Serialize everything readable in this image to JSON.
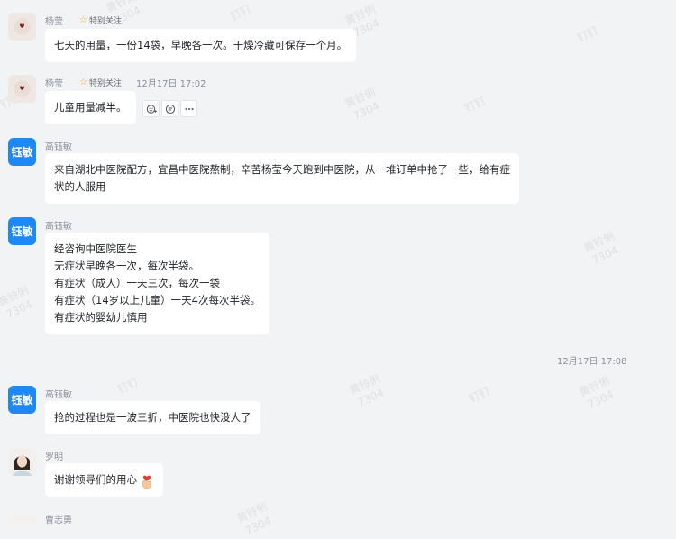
{
  "watermark": {
    "name": "黄铃俐",
    "code": "7304",
    "brand": "钉钉"
  },
  "messages": [
    {
      "sender": "杨莹",
      "special_tag": "特别关注",
      "time": "",
      "lines": [
        "七天的用量，一份14袋，早晚各一次。干燥冷藏可保存一个月。"
      ]
    },
    {
      "sender": "杨莹",
      "special_tag": "特别关注",
      "time": "12月17日 17:02",
      "lines": [
        "儿童用量减半。"
      ]
    },
    {
      "sender": "高钰敏",
      "avatar_text": "钰敏",
      "lines": [
        "来自湖北中医院配方，宜昌中医院熬制，辛苦杨莹今天跑到中医院，从一堆订单中抢了一些，给有症",
        "状的人服用"
      ]
    },
    {
      "sender": "高钰敏",
      "avatar_text": "钰敏",
      "lines": [
        "经咨询中医院医生",
        "无症状早晚各一次，每次半袋。",
        "有症状（成人）一天三次，每次一袋",
        "有症状（14岁以上儿童）一天4次每次半袋。",
        "有症状的婴幼儿慎用"
      ]
    },
    {
      "sender": "高钰敏",
      "avatar_text": "钰敏",
      "lines": [
        "抢的过程也是一波三折，中医院也快没人了"
      ]
    },
    {
      "sender": "罗明",
      "lines": [
        "谢谢领导们的用心"
      ]
    },
    {
      "sender": "曹志勇"
    }
  ],
  "time_separator": "12月17日 17:08",
  "icons": {
    "star": "star-icon",
    "add_reaction": "add-reaction-icon",
    "reply": "reply-icon",
    "more": "more-icon",
    "thanks_emoji": "heart-hand-emoji-icon"
  }
}
